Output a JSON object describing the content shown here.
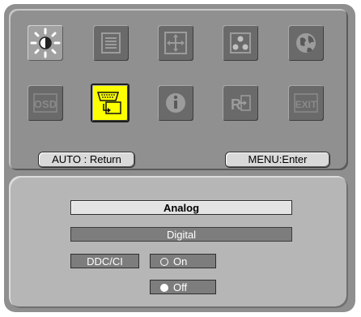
{
  "menu": {
    "icons": [
      {
        "name": "brightness-icon",
        "state": "highlighted"
      },
      {
        "name": "picture-list-icon",
        "state": "normal"
      },
      {
        "name": "position-move-icon",
        "state": "normal"
      },
      {
        "name": "color-dots-icon",
        "state": "normal"
      },
      {
        "name": "globe-language-icon",
        "state": "normal"
      },
      {
        "name": "osd-icon",
        "label": "OSD",
        "state": "dim"
      },
      {
        "name": "input-signal-icon",
        "state": "selected"
      },
      {
        "name": "info-icon",
        "state": "normal"
      },
      {
        "name": "reset-icon",
        "label": "R",
        "state": "normal"
      },
      {
        "name": "exit-icon",
        "label": "EXIT",
        "state": "dim"
      }
    ],
    "auto_hint": "AUTO : Return",
    "menu_hint": "MENU:Enter"
  },
  "submenu": {
    "analog": "Analog",
    "digital": "Digital",
    "ddc_label": "DDC/CI",
    "on_label": "On",
    "off_label": "Off",
    "selected_input": "Analog",
    "ddc_state": "Off"
  },
  "colors": {
    "selected_tile": "#fbff00",
    "panel": "#909090",
    "bottom_panel": "#b6b6b6"
  }
}
